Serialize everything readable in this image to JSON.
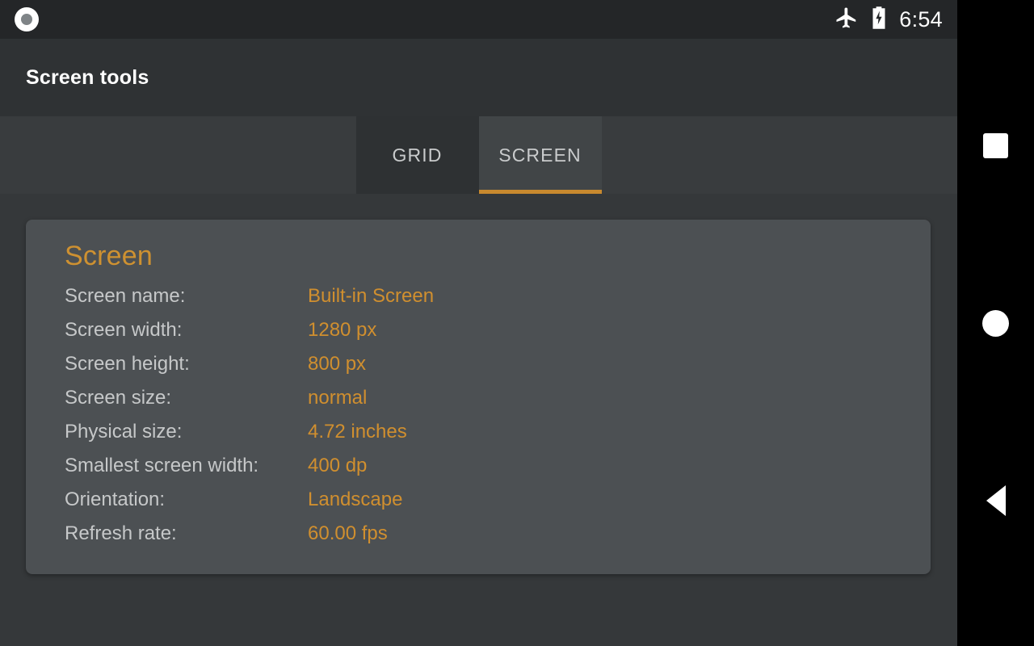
{
  "status_bar": {
    "notification_icon": "notification-dot-icon",
    "airplane_icon": "airplane-mode-icon",
    "battery_icon": "battery-charging-icon",
    "time": "6:54"
  },
  "app_bar": {
    "title": "Screen tools"
  },
  "tabs": [
    {
      "label": "GRID",
      "active": false,
      "name": "tab-grid"
    },
    {
      "label": "SCREEN",
      "active": true,
      "name": "tab-screen"
    }
  ],
  "card": {
    "title": "Screen",
    "rows": [
      {
        "label": "Screen name:",
        "value": "Built-in Screen"
      },
      {
        "label": "Screen width:",
        "value": "1280 px"
      },
      {
        "label": "Screen height:",
        "value": "800 px"
      },
      {
        "label": "Screen size:",
        "value": "normal"
      },
      {
        "label": "Physical size:",
        "value": "4.72 inches"
      },
      {
        "label": "Smallest screen width:",
        "value": "400 dp"
      },
      {
        "label": "Orientation:",
        "value": "Landscape"
      },
      {
        "label": "Refresh rate:",
        "value": "60.00 fps"
      }
    ]
  },
  "nav_bar": {
    "recents_label": "recents-square-icon",
    "home_label": "home-circle-icon",
    "back_label": "back-triangle-icon"
  },
  "colors": {
    "accent_orange": "#c8892e",
    "title_orange": "#ce9131",
    "value_orange": "#d08f2f",
    "card_bg": "#4c5053",
    "page_bg": "#35383a",
    "app_bar_bg": "#2f3234",
    "status_bar_bg": "#242628",
    "tab_inactive_bg": "#2e3133",
    "tab_active_bg": "#414547",
    "nav_bar_bg": "#000000",
    "label_gray": "#c6c8c9"
  }
}
